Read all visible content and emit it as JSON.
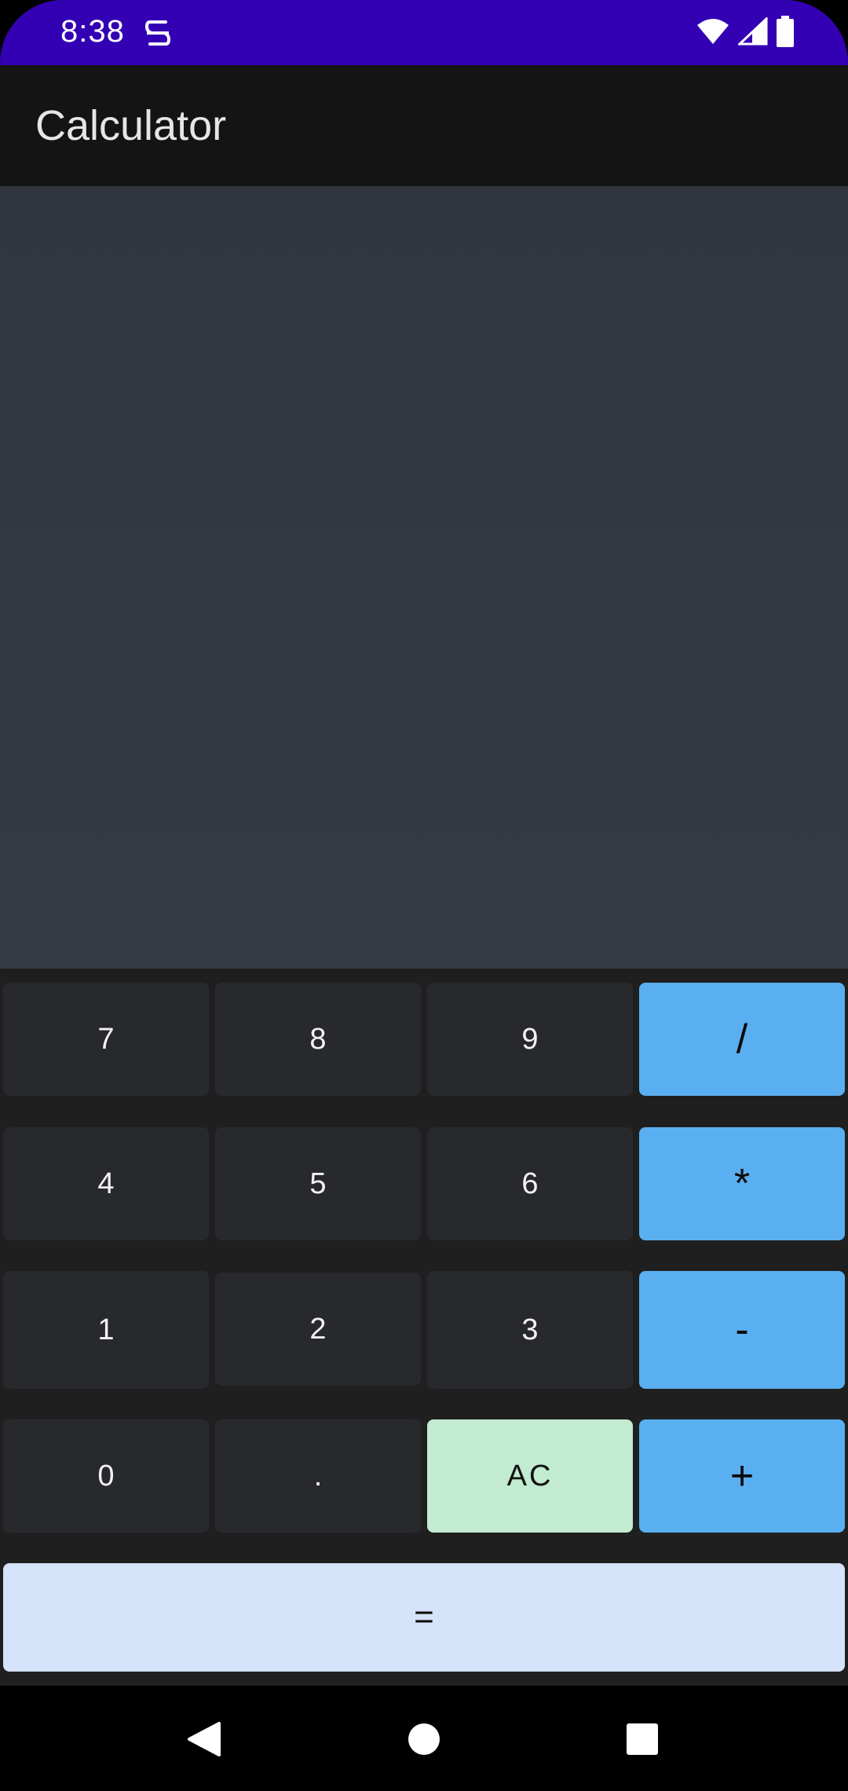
{
  "status_bar": {
    "time": "8:38",
    "icons": [
      "notification-app-icon",
      "wifi-icon",
      "cell-signal-icon",
      "battery-icon"
    ],
    "background": "#3300b3"
  },
  "app_bar": {
    "title": "Calculator"
  },
  "display": {
    "expression": ""
  },
  "keypad": {
    "row1": [
      "7",
      "8",
      "9",
      "/"
    ],
    "row2": [
      "4",
      "5",
      "6",
      "*"
    ],
    "row3": [
      "1",
      "2",
      "3",
      "-"
    ],
    "row4": [
      "0",
      ".",
      "AC",
      "+"
    ],
    "equals": "="
  },
  "nav_bar": {
    "icons": [
      "back-icon",
      "home-icon",
      "recents-icon"
    ]
  },
  "colors": {
    "operator": "#5aaff0",
    "clear": "#c2ebd1",
    "equals": "#d5e3fb",
    "number": "#28292d"
  }
}
